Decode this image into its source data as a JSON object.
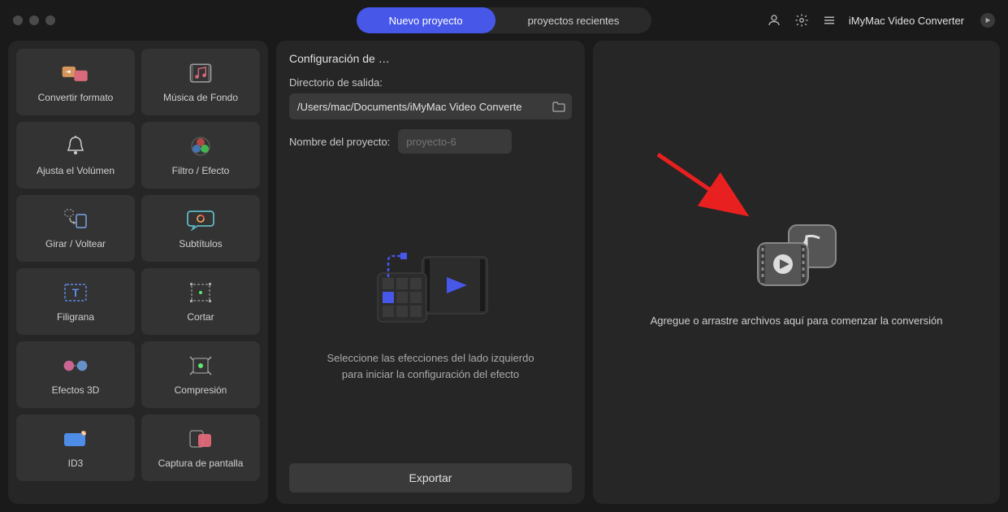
{
  "titlebar": {
    "tab_new": "Nuevo proyecto",
    "tab_recent": "proyectos recientes",
    "app_title": "iMyMac Video Converter"
  },
  "sidebar": {
    "tiles": [
      {
        "id": "convert",
        "label": "Convertir formato"
      },
      {
        "id": "bgmusic",
        "label": "Música de Fondo"
      },
      {
        "id": "volume",
        "label": "Ajusta el Volúmen"
      },
      {
        "id": "filter",
        "label": "Filtro / Efecto"
      },
      {
        "id": "rotate",
        "label": "Girar / Voltear"
      },
      {
        "id": "subs",
        "label": "Subtítulos"
      },
      {
        "id": "watermark",
        "label": "Filigrana"
      },
      {
        "id": "crop",
        "label": "Cortar"
      },
      {
        "id": "3d",
        "label": "Efectos 3D"
      },
      {
        "id": "compress",
        "label": "Compresión"
      },
      {
        "id": "id3",
        "label": "ID3"
      },
      {
        "id": "screenshot",
        "label": "Captura de pantalla"
      }
    ]
  },
  "config": {
    "title": "Configuración de …",
    "dir_label": "Directorio de salida:",
    "dir_value": "/Users/mac/Documents/iMyMac Video Converte",
    "proj_label": "Nombre del proyecto:",
    "proj_placeholder": "proyecto-6",
    "center_text1": "Seleccione las efecciones del lado izquierdo",
    "center_text2": "para iniciar la configuración del efecto",
    "export": "Exportar"
  },
  "drop": {
    "text": "Agregue o arrastre archivos aquí para comenzar la conversión"
  }
}
